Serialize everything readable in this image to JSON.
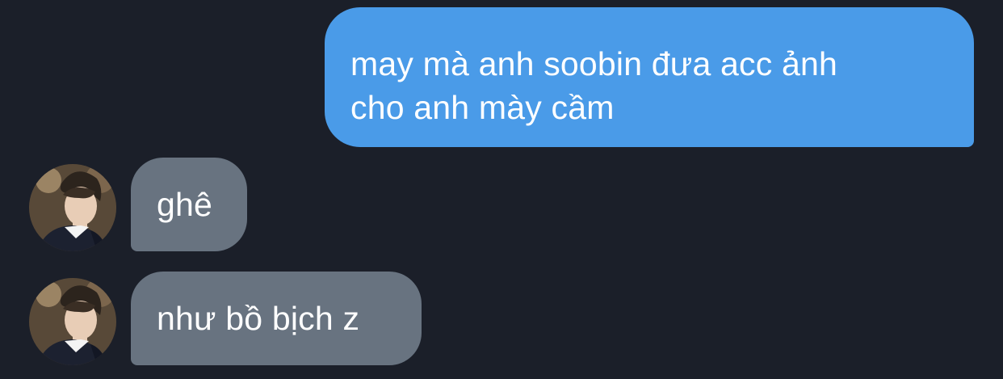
{
  "conversation": {
    "messages": [
      {
        "direction": "sent",
        "text": "may mà anh soobin đưa acc ảnh\ncho anh mày cầm"
      },
      {
        "direction": "received",
        "text": "ghê"
      },
      {
        "direction": "received",
        "text": "như bồ bịch z"
      }
    ]
  },
  "colors": {
    "background": "#1b1f29",
    "sent_bubble": "#4a9be8",
    "received_bubble": "#687380",
    "bubble_text": "#ffffff"
  },
  "icons": {
    "avatar": "user-avatar-photo"
  }
}
